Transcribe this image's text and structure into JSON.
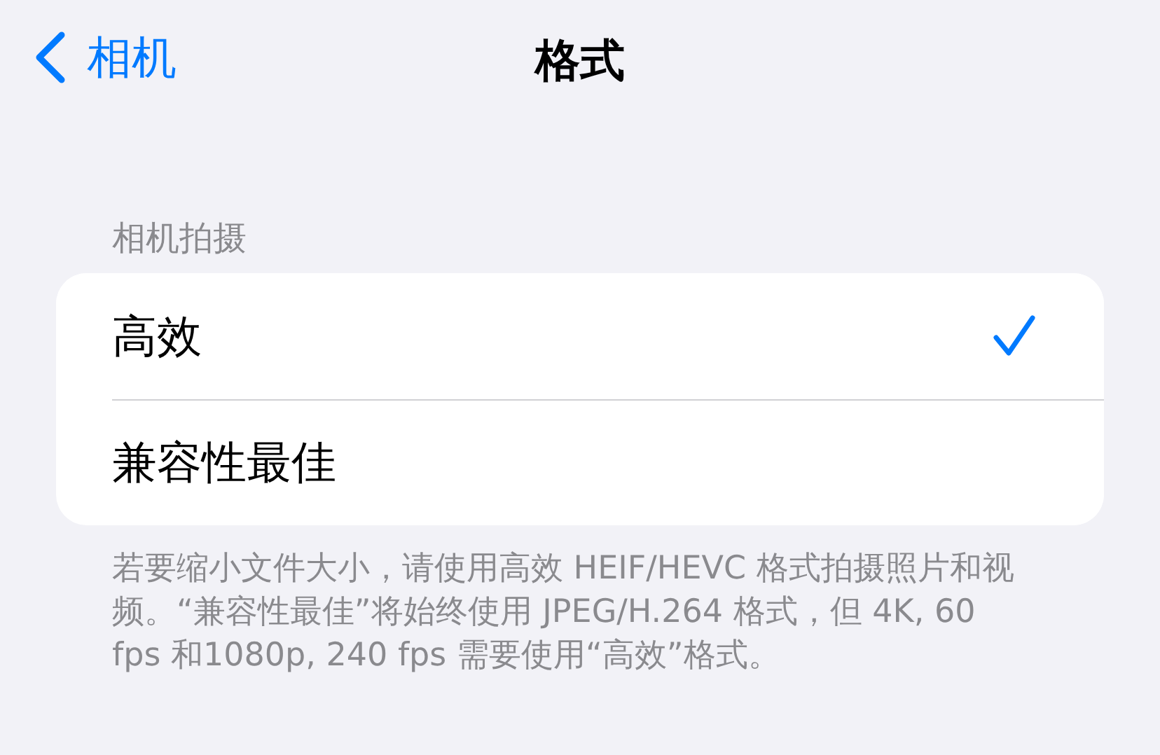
{
  "nav": {
    "back_label": "相机",
    "title": "格式"
  },
  "section": {
    "header": "相机拍摄",
    "options": [
      {
        "label": "高效",
        "selected": true
      },
      {
        "label": "兼容性最佳",
        "selected": false
      }
    ],
    "footer": "若要缩小文件大小，请使用高效 HEIF/HEVC 格式拍摄照片和视频。“兼容性最佳”将始终使用 JPEG/H.264 格式，但 4K, 60 fps 和1080p, 240 fps 需要使用“高效”格式。"
  }
}
